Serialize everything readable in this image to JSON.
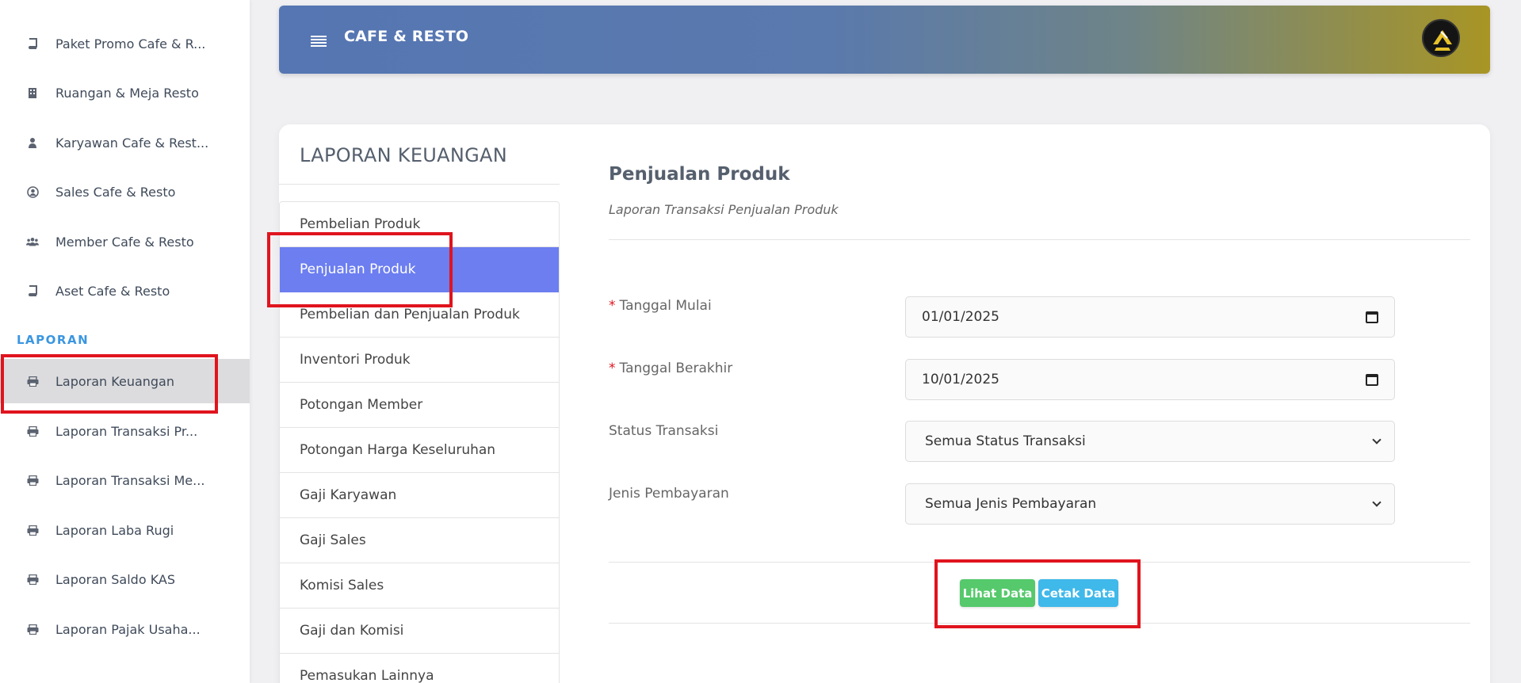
{
  "sidebar": {
    "items_top": [
      {
        "label": "Paket Promo Cafe & R...",
        "icon": "book-icon"
      },
      {
        "label": "Ruangan & Meja Resto",
        "icon": "building-icon"
      },
      {
        "label": "Karyawan Cafe & Rest...",
        "icon": "user-tie-icon"
      },
      {
        "label": "Sales Cafe & Resto",
        "icon": "user-circle-icon"
      },
      {
        "label": "Member Cafe & Resto",
        "icon": "users-icon"
      },
      {
        "label": "Aset Cafe & Resto",
        "icon": "book-icon"
      }
    ],
    "section_heading": "LAPORAN",
    "items_report": [
      {
        "label": "Laporan Keuangan",
        "icon": "print-icon",
        "active": true
      },
      {
        "label": "Laporan Transaksi Pr...",
        "icon": "print-icon"
      },
      {
        "label": "Laporan Transaksi Me...",
        "icon": "print-icon"
      },
      {
        "label": "Laporan Laba Rugi",
        "icon": "print-icon"
      },
      {
        "label": "Laporan Saldo KAS",
        "icon": "print-icon"
      },
      {
        "label": "Laporan Pajak Usaha...",
        "icon": "print-icon"
      }
    ]
  },
  "header": {
    "title": "CAFE & RESTO",
    "menu_icon": "hamburger-icon",
    "avatar_icon": "logo-avatar"
  },
  "report_menu": {
    "title": "LAPORAN KEUANGAN",
    "items": [
      {
        "label": "Pembelian Produk"
      },
      {
        "label": "Penjualan Produk",
        "active": true
      },
      {
        "label": "Pembelian dan Penjualan Produk"
      },
      {
        "label": "Inventori Produk"
      },
      {
        "label": "Potongan Member"
      },
      {
        "label": "Potongan Harga Keseluruhan"
      },
      {
        "label": "Gaji Karyawan"
      },
      {
        "label": "Gaji Sales"
      },
      {
        "label": "Komisi Sales"
      },
      {
        "label": "Gaji dan Komisi"
      },
      {
        "label": "Pemasukan Lainnya"
      }
    ]
  },
  "form": {
    "title": "Penjualan Produk",
    "subtitle": "Laporan Transaksi Penjualan Produk",
    "required_mark": "*",
    "start_date": {
      "label": "Tanggal Mulai",
      "value": "01/01/2025"
    },
    "end_date": {
      "label": "Tanggal Berakhir",
      "value": "10/01/2025"
    },
    "status": {
      "label": "Status Transaksi",
      "value": "Semua Status Transaksi"
    },
    "payment": {
      "label": "Jenis Pembayaran",
      "value": "Semua Jenis Pembayaran"
    },
    "view_button": "Lihat Data",
    "print_button": "Cetak Data"
  },
  "colors": {
    "active_menu": "#6c7ef0",
    "highlight": "#e0141e",
    "view_button": "#55c96b",
    "print_button": "#3fb8ea",
    "section_heading": "#3b96e0"
  }
}
